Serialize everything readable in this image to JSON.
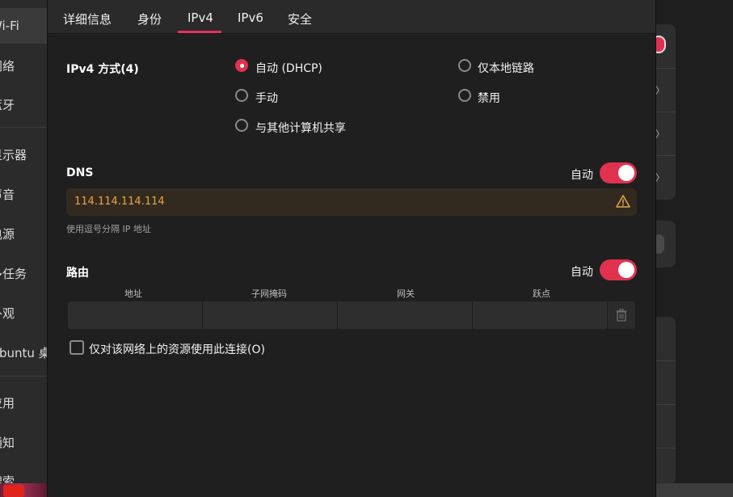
{
  "background": {
    "sidebar": [
      "Wi-Fi",
      "网络",
      "蓝牙",
      "显示器",
      "声音",
      "电源",
      "多任务",
      "外观",
      "Ubuntu 桌面",
      "应用",
      "通知",
      "搜索"
    ]
  },
  "tabs": [
    {
      "label": "详细信息"
    },
    {
      "label": "身份"
    },
    {
      "label": "IPv4"
    },
    {
      "label": "IPv6"
    },
    {
      "label": "安全"
    }
  ],
  "ipv4": {
    "method_label": "IPv4 方式(4)",
    "options": [
      {
        "label": "自动 (DHCP)",
        "selected": true
      },
      {
        "label": "手动",
        "selected": false
      },
      {
        "label": "与其他计算机共享",
        "selected": false
      },
      {
        "label": "仅本地链路",
        "selected": false
      },
      {
        "label": "禁用",
        "selected": false
      }
    ]
  },
  "dns": {
    "label": "DNS",
    "auto_label": "自动",
    "auto_on": true,
    "value": "114.114.114.114",
    "hint": "使用逗号分隔 IP 地址"
  },
  "routes": {
    "label": "路由",
    "auto_label": "自动",
    "auto_on": true,
    "columns": [
      "地址",
      "子网掩码",
      "网关",
      "跃点"
    ]
  },
  "only_local_resources": {
    "label": "仅对该网络上的资源使用此连接(O)",
    "checked": false
  },
  "colors": {
    "accent": "#e0324f",
    "warning": "#e3a64b"
  }
}
